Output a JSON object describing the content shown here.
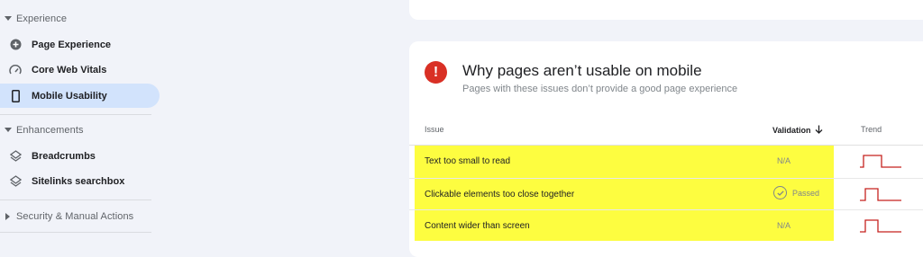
{
  "sidebar": {
    "experience_header": "Experience",
    "experience_items": [
      {
        "label": "Page Experience",
        "icon": "plus-circle-icon"
      },
      {
        "label": "Core Web Vitals",
        "icon": "gauge-icon"
      },
      {
        "label": "Mobile Usability",
        "icon": "phone-icon",
        "active": true
      }
    ],
    "enhancements_header": "Enhancements",
    "enhancements_items": [
      {
        "label": "Breadcrumbs",
        "icon": "layers-icon"
      },
      {
        "label": "Sitelinks searchbox",
        "icon": "layers-icon"
      }
    ],
    "security_header": "Security & Manual Actions"
  },
  "card": {
    "title": "Why pages aren’t usable on mobile",
    "subtitle": "Pages with these issues don’t provide a good page experience",
    "columns": {
      "issue": "Issue",
      "validation": "Validation",
      "trend": "Trend"
    },
    "rows": [
      {
        "issue": "Text too small to read",
        "validation": "N/A"
      },
      {
        "issue": "Clickable elements too close together",
        "validation": "Passed"
      },
      {
        "issue": "Content wider than screen",
        "validation": "N/A"
      }
    ]
  },
  "colors": {
    "active_nav_bg": "#d2e3fc",
    "error_icon": "#d93025",
    "highlight": "#fdfd40",
    "trend_line": "#c5221f"
  }
}
